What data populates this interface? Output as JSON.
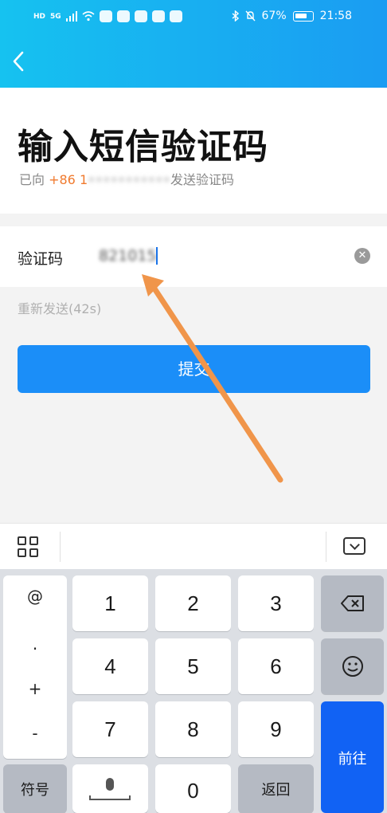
{
  "status_bar": {
    "left_chips": [
      "HD",
      "5G"
    ],
    "battery": "67%",
    "time": "21:58"
  },
  "nav": {
    "back_icon": "chevron-left"
  },
  "header": {
    "title": "输入短信验证码",
    "subtitle_prefix": "已向 ",
    "subtitle_phone": "+86 1",
    "subtitle_masked": "•••••••••••",
    "subtitle_suffix": "发送验证码"
  },
  "form": {
    "label": "验证码",
    "value": "821015",
    "clear_icon": "✕",
    "resend": "重新发送(42s)",
    "submit": "提交"
  },
  "keyboard": {
    "symbols": [
      "@",
      ".",
      "+",
      "-"
    ],
    "digits": [
      "1",
      "2",
      "3",
      "4",
      "5",
      "6",
      "7",
      "8",
      "9",
      "0"
    ],
    "backspace_icon": "⌫",
    "emoji_icon": "☺",
    "symbols_key": "符号",
    "back_key": "返回",
    "go_key": "前往"
  },
  "colors": {
    "accent": "#1b8ef8",
    "phone": "#f07a2e",
    "go_key": "#1162f4",
    "annotation_arrow": "#f0954a"
  }
}
